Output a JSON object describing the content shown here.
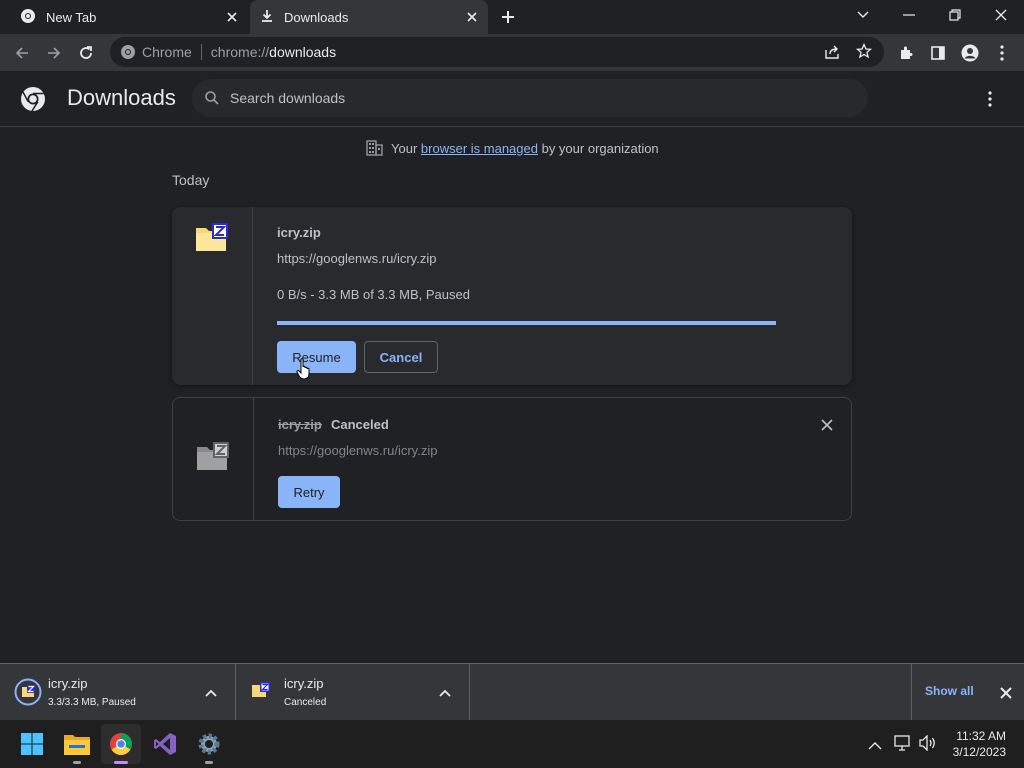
{
  "tabs": [
    {
      "title": "New Tab"
    },
    {
      "title": "Downloads"
    }
  ],
  "omnibox": {
    "chip": "Chrome",
    "url_scheme": "chrome://",
    "url_host": "downloads"
  },
  "header": {
    "title": "Downloads",
    "search_placeholder": "Search downloads"
  },
  "managed": {
    "prefix": "Your",
    "link": "browser is managed",
    "suffix": "by your organization"
  },
  "section": {
    "label": "Today"
  },
  "downloads": [
    {
      "filename": "icry.zip",
      "url": "https://googlenws.ru/icry.zip",
      "status": "0 B/s - 3.3 MB of 3.3 MB, Paused",
      "progress": 1.0,
      "resume_label": "Resume",
      "cancel_label": "Cancel"
    },
    {
      "filename": "icry.zip",
      "state": "Canceled",
      "url": "https://googlenws.ru/icry.zip",
      "retry_label": "Retry"
    }
  ],
  "shelf": {
    "items": [
      {
        "name": "icry.zip",
        "sub": "3.3/3.3 MB, Paused"
      },
      {
        "name": "icry.zip",
        "sub": "Canceled"
      }
    ],
    "show_all": "Show all"
  },
  "clock": {
    "time": "11:32 AM",
    "date": "3/12/2023"
  },
  "colors": {
    "accent": "#8ab4f8",
    "background": "#202124",
    "toolbar": "#35363a"
  }
}
